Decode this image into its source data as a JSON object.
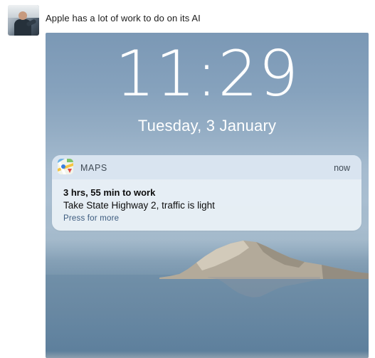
{
  "post": {
    "text": "Apple has a lot of work to do on its AI"
  },
  "lockscreen": {
    "time": "11:29",
    "date": "Tuesday, 3 January"
  },
  "notification": {
    "app_icon": "maps-icon",
    "app_name": "MAPS",
    "time": "now",
    "title": "3 hrs, 55 min to work",
    "body": "Take State Highway 2, traffic is light",
    "action": "Press for more"
  },
  "colors": {
    "sky": "#86a2bd",
    "sea": "#6a89a3",
    "notification_bg": "#ecf2f7",
    "action_text": "#3b5a7e"
  }
}
